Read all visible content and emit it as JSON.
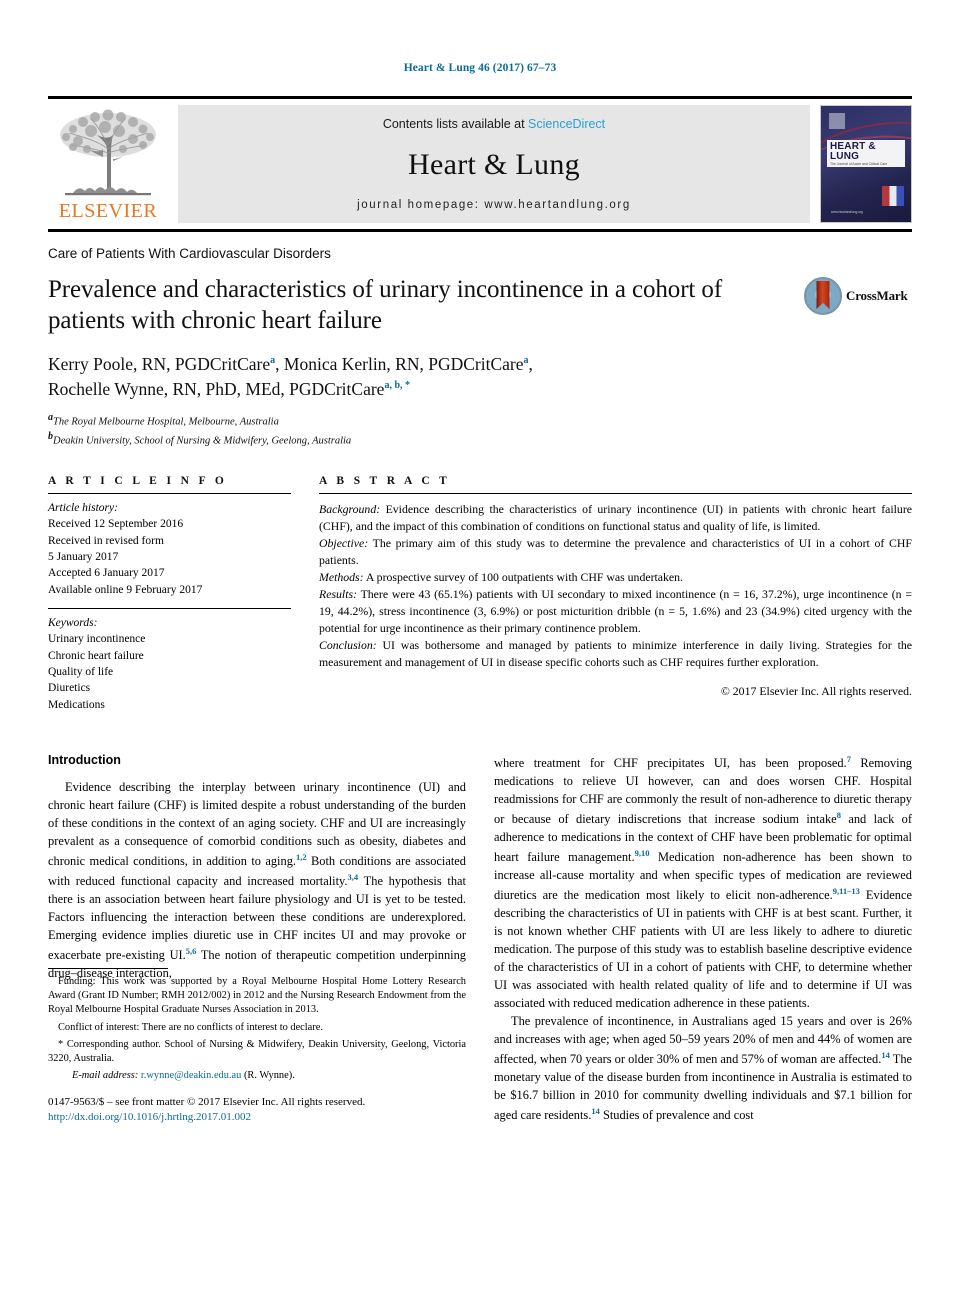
{
  "running_head": "Heart & Lung 46 (2017) 67–73",
  "masthead": {
    "publisher_wordmark": "ELSEVIER",
    "contents_prefix": "Contents lists available at ",
    "contents_link": "ScienceDirect",
    "journal_name": "Heart & Lung",
    "homepage": "journal homepage: www.heartandlung.org",
    "cover": {
      "title": "HEART & LUNG",
      "subtitle": "The Journal of Acute and Critical Care",
      "url": "www.heartandlung.org"
    }
  },
  "section_kicker": "Care of Patients With Cardiovascular Disorders",
  "title": "Prevalence and characteristics of urinary incontinence in a cohort of patients with chronic heart failure",
  "crossmark_label": "CrossMark",
  "authors": [
    {
      "name": "Kerry Poole, RN, PGDCritCare",
      "sup": "a",
      "sep": ", "
    },
    {
      "name": "Monica Kerlin, RN, PGDCritCare",
      "sup": "a",
      "sep": ","
    },
    {
      "name": "Rochelle Wynne, RN, PhD, MEd, PGDCritCare",
      "sup": "a, b, *",
      "sep": ""
    }
  ],
  "affiliations": [
    {
      "sup": "a",
      "text": "The Royal Melbourne Hospital, Melbourne, Australia"
    },
    {
      "sup": "b",
      "text": "Deakin University, School of Nursing & Midwifery, Geelong, Australia"
    }
  ],
  "article_info": {
    "heading": "A R T I C L E  I N F O",
    "history_label": "Article history:",
    "history": [
      "Received 12 September 2016",
      "Received in revised form",
      "5 January 2017",
      "Accepted 6 January 2017",
      "Available online 9 February 2017"
    ],
    "keywords_label": "Keywords:",
    "keywords": [
      "Urinary incontinence",
      "Chronic heart failure",
      "Quality of life",
      "Diuretics",
      "Medications"
    ]
  },
  "abstract": {
    "heading": "A B S T R A C T",
    "sections": [
      {
        "label": "Background:",
        "text": " Evidence describing the characteristics of urinary incontinence (UI) in patients with chronic heart failure (CHF), and the impact of this combination of conditions on functional status and quality of life, is limited."
      },
      {
        "label": "Objective:",
        "text": " The primary aim of this study was to determine the prevalence and characteristics of UI in a cohort of CHF patients."
      },
      {
        "label": "Methods:",
        "text": " A prospective survey of 100 outpatients with CHF was undertaken."
      },
      {
        "label": "Results:",
        "text": " There were 43 (65.1%) patients with UI secondary to mixed incontinence (n = 16, 37.2%), urge incontinence (n = 19, 44.2%), stress incontinence (3, 6.9%) or post micturition dribble (n = 5, 1.6%) and 23 (34.9%) cited urgency with the potential for urge incontinence as their primary continence problem."
      },
      {
        "label": "Conclusion:",
        "text": " UI was bothersome and managed by patients to minimize interference in daily living. Strategies for the measurement and management of UI in disease specific cohorts such as CHF requires further exploration."
      }
    ],
    "copyright": "© 2017 Elsevier Inc. All rights reserved."
  },
  "body": {
    "intro_heading": "Introduction",
    "left_paragraphs": [
      {
        "runs": [
          {
            "t": "Evidence describing the interplay between urinary incontinence (UI) and chronic heart failure (CHF) is limited despite a robust understanding of the burden of these conditions in the context of an aging society. CHF and UI are increasingly prevalent as a consequence of comorbid conditions such as obesity, diabetes and chronic medical conditions, in addition to aging."
          },
          {
            "t": "1,2",
            "ref": true
          },
          {
            "t": " Both conditions are associated with reduced functional capacity and increased mortality."
          },
          {
            "t": "3,4",
            "ref": true
          },
          {
            "t": " The hypothesis that there is an association between heart failure physiology and UI is yet to be tested. Factors influencing the interaction between these conditions are underexplored. Emerging evidence implies diuretic use in CHF incites UI and may provoke or exacerbate pre-existing UI."
          },
          {
            "t": "5,6",
            "ref": true
          },
          {
            "t": " The notion of therapeutic competition underpinning drug–disease interaction,"
          }
        ]
      }
    ],
    "right_paragraphs": [
      {
        "runs": [
          {
            "t": "where treatment for CHF precipitates UI, has been proposed."
          },
          {
            "t": "7",
            "ref": true
          },
          {
            "t": " Removing medications to relieve UI however, can and does worsen CHF. Hospital readmissions for CHF are commonly the result of non-adherence to diuretic therapy or because of dietary indiscretions that increase sodium intake"
          },
          {
            "t": "8",
            "ref": true
          },
          {
            "t": " and lack of adherence to medications in the context of CHF have been problematic for optimal heart failure management."
          },
          {
            "t": "9,10",
            "ref": true
          },
          {
            "t": " Medication non-adherence has been shown to increase all-cause mortality and when specific types of medication are reviewed diuretics are the medication most likely to elicit non-adherence."
          },
          {
            "t": "9,11–13",
            "ref": true
          },
          {
            "t": " Evidence describing the characteristics of UI in patients with CHF is at best scant. Further, it is not known whether CHF patients with UI are less likely to adhere to diuretic medication. The purpose of this study was to establish baseline descriptive evidence of the characteristics of UI in a cohort of patients with CHF, to determine whether UI was associated with health related quality of life and to determine if UI was associated with reduced medication adherence in these patients."
          }
        ],
        "indent": false
      },
      {
        "runs": [
          {
            "t": "The prevalence of incontinence, in Australians aged 15 years and over is 26% and increases with age; when aged 50–59 years 20% of men and 44% of women are affected, when 70 years or older 30% of men and 57% of woman are affected."
          },
          {
            "t": "14",
            "ref": true
          },
          {
            "t": " The monetary value of the disease burden from incontinence in Australia is estimated to be $16.7 billion in 2010 for community dwelling individuals and $7.1 billion for aged care residents."
          },
          {
            "t": "14",
            "ref": true
          },
          {
            "t": " Studies of prevalence and cost"
          }
        ],
        "indent": true
      }
    ]
  },
  "footnotes": {
    "funding": "Funding: This work was supported by a Royal Melbourne Hospital Home Lottery Research Award (Grant ID Number; RMH 2012/002) in 2012 and the Nursing Research Endowment from the Royal Melbourne Hospital Graduate Nurses Association in 2013.",
    "conflict": "Conflict of interest: There are no conflicts of interest to declare.",
    "corresponding": "* Corresponding author. School of Nursing & Midwifery, Deakin University, Geelong, Victoria 3220, Australia.",
    "email_label": "E-mail address:",
    "email": "r.wynne@deakin.edu.au",
    "email_suffix": " (R. Wynne).",
    "issn_line": "0147-9563/$ – see front matter © 2017 Elsevier Inc. All rights reserved.",
    "doi": "http://dx.doi.org/10.1016/j.hrtlng.2017.01.002"
  },
  "colors": {
    "link": "#0b6a96",
    "sciencedirect": "#2a9fd6",
    "elsevier_orange": "#e87722",
    "band_gray": "#e6e6e6"
  }
}
